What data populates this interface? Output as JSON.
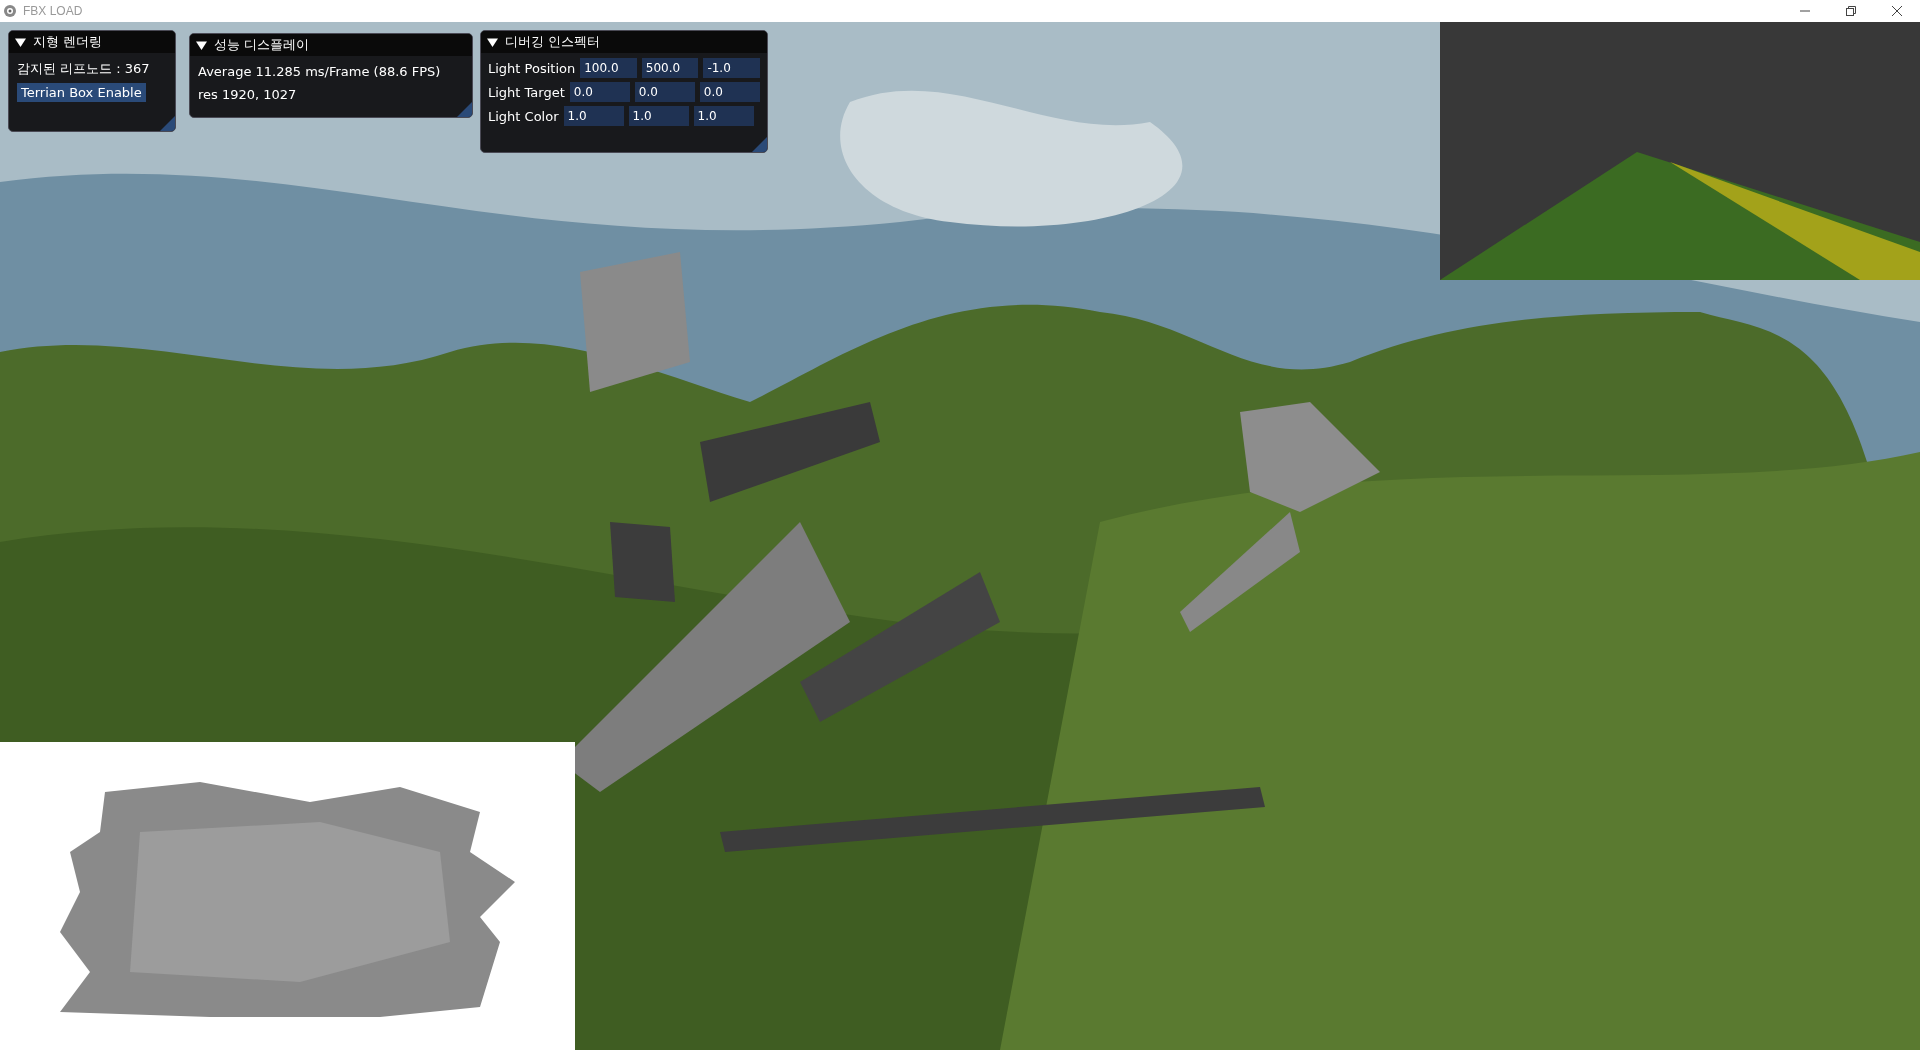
{
  "window": {
    "title": "FBX LOAD"
  },
  "panels": [
    {
      "title": "지형 렌더링",
      "expanded": true,
      "items": [
        {
          "kind": "text",
          "text": "감지된 리프노드 : 367"
        },
        {
          "kind": "button",
          "text": "Terrian Box Enable"
        }
      ]
    },
    {
      "title": "성능 디스플레이",
      "expanded": true,
      "items": [
        {
          "kind": "text",
          "text": "Average 11.285 ms/Frame (88.6 FPS)"
        },
        {
          "kind": "text",
          "text": "res 1920, 1027"
        }
      ]
    },
    {
      "title": "디버깅 인스펙터",
      "expanded": true,
      "items": [
        {
          "kind": "vector",
          "label": "Light Position",
          "values": [
            "100.0",
            "500.0",
            "-1.0"
          ]
        },
        {
          "kind": "vector",
          "label": "Light Target",
          "values": [
            "0.0",
            "0.0",
            "0.0"
          ]
        },
        {
          "kind": "vector",
          "label": "Light Color",
          "values": [
            "1.0",
            "1.0",
            "1.0"
          ]
        }
      ]
    }
  ]
}
